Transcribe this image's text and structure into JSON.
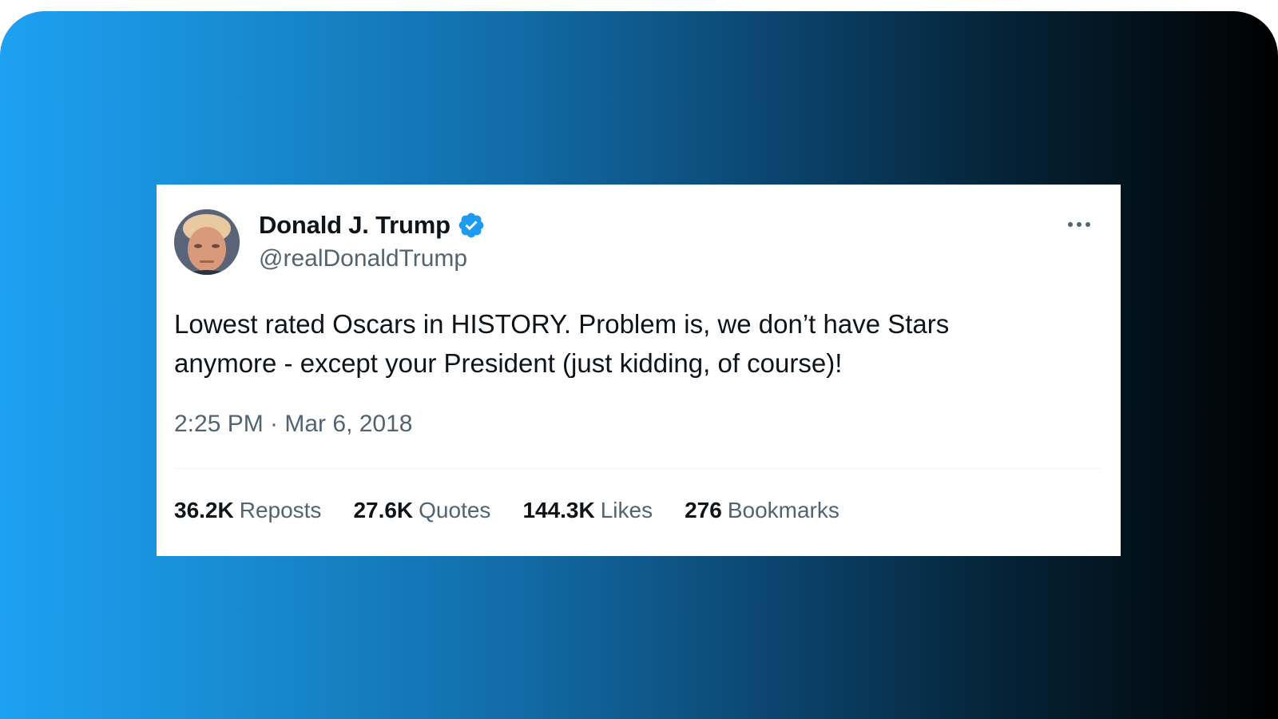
{
  "tweet": {
    "author": {
      "display_name": "Donald J. Trump",
      "handle": "@realDonaldTrump",
      "verified": true,
      "verified_color": "#1d9bf0"
    },
    "text": "Lowest rated Oscars in HISTORY. Problem is, we don’t have Stars\nanymore - except your President (just kidding, of course)!",
    "timestamp": "2:25 PM · Mar 6, 2018",
    "stats": [
      {
        "count": "36.2K",
        "label": "Reposts"
      },
      {
        "count": "27.6K",
        "label": "Quotes"
      },
      {
        "count": "144.3K",
        "label": "Likes"
      },
      {
        "count": "276",
        "label": "Bookmarks"
      }
    ],
    "icons": {
      "more": "more-horizontal-icon",
      "verified": "verified-badge-icon",
      "avatar": "profile-avatar"
    }
  },
  "theme": {
    "gradient_start": "#1da1f2",
    "gradient_end": "#000000",
    "text_primary": "#0f1419",
    "text_secondary": "#536471"
  }
}
